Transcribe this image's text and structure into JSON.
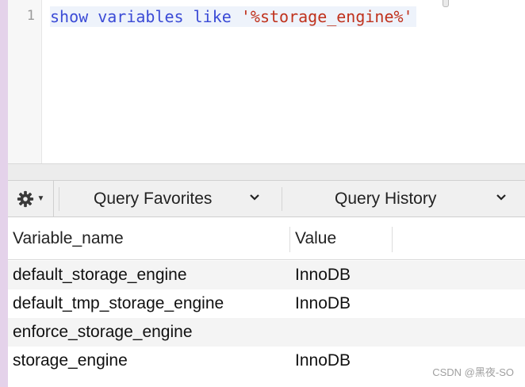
{
  "editor": {
    "line_number": "1",
    "code": {
      "kw1": "show",
      "kw2": "variables",
      "kw3": "like",
      "str": "'%storage_engine%'"
    }
  },
  "toolbar": {
    "favorites_label": "Query Favorites",
    "history_label": "Query History"
  },
  "results": {
    "columns": [
      "Variable_name",
      "Value"
    ],
    "rows": [
      [
        "default_storage_engine",
        "InnoDB"
      ],
      [
        "default_tmp_storage_engine",
        "InnoDB"
      ],
      [
        "enforce_storage_engine",
        ""
      ],
      [
        "storage_engine",
        "InnoDB"
      ]
    ]
  },
  "watermark": "CSDN @黑夜-SO",
  "colors": {
    "keyword": "#3b4bd6",
    "string": "#c0321d",
    "sidebar_strip": "#e4d2ea"
  }
}
